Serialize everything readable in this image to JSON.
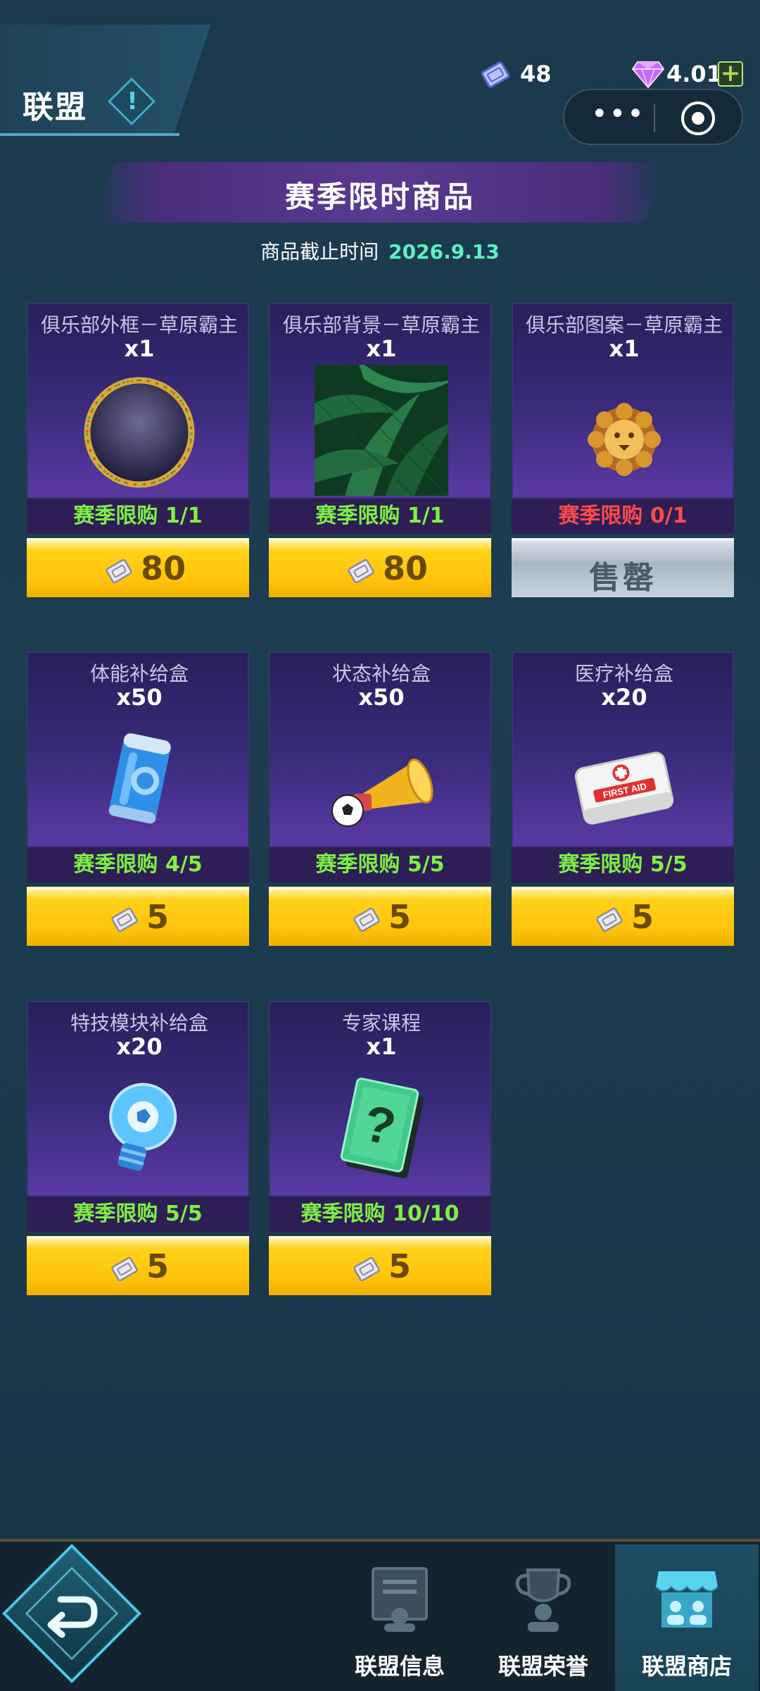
{
  "header": {
    "title": "联盟",
    "info_glyph": "!",
    "tickets": "48",
    "gems": "4.01K",
    "plus": "+",
    "more_dots": "•••"
  },
  "banner": {
    "title": "赛季限时商品",
    "deadline_label": "商品截止时间",
    "deadline_date": "2026.9.13"
  },
  "items": [
    {
      "name": "俱乐部外框－草原霸主",
      "qty": "x1",
      "limit": "赛季限购 1/1",
      "price": "80",
      "sold_out": false,
      "icon": "frame-icon"
    },
    {
      "name": "俱乐部背景－草原霸主",
      "qty": "x1",
      "limit": "赛季限购 1/1",
      "price": "80",
      "sold_out": false,
      "icon": "leaf-background-icon"
    },
    {
      "name": "俱乐部图案－草原霸主",
      "qty": "x1",
      "limit": "赛季限购 0/1",
      "price": "售罄",
      "sold_out": true,
      "icon": "lion-emblem-icon"
    },
    {
      "name": "体能补给盒",
      "qty": "x50",
      "limit": "赛季限购 4/5",
      "price": "5",
      "sold_out": false,
      "icon": "energy-can-icon"
    },
    {
      "name": "状态补给盒",
      "qty": "x50",
      "limit": "赛季限购 5/5",
      "price": "5",
      "sold_out": false,
      "icon": "horn-ball-icon"
    },
    {
      "name": "医疗补给盒",
      "qty": "x20",
      "limit": "赛季限购 5/5",
      "price": "5",
      "sold_out": false,
      "icon": "first-aid-icon"
    },
    {
      "name": "特技模块补给盒",
      "qty": "x20",
      "limit": "赛季限购 5/5",
      "price": "5",
      "sold_out": false,
      "icon": "lightbulb-icon"
    },
    {
      "name": "专家课程",
      "qty": "x1",
      "limit": "赛季限购 10/10",
      "price": "5",
      "sold_out": false,
      "icon": "tactics-book-icon"
    }
  ],
  "first_aid_text": "FIRST AID",
  "nav": {
    "tabs": [
      {
        "label": "联盟信息",
        "active": false
      },
      {
        "label": "联盟荣誉",
        "active": false
      },
      {
        "label": "联盟商店",
        "active": true
      }
    ]
  },
  "colors": {
    "limit_ok": "#7ef043",
    "limit_soldout": "#ff4b4b",
    "deadline": "#5ef0c4",
    "price_button": "#ffc30a"
  }
}
